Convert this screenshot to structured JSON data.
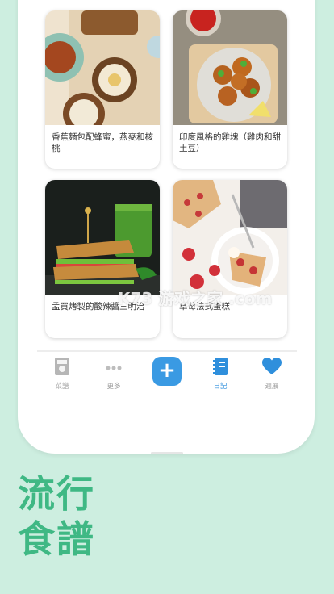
{
  "cards": [
    {
      "caption": "香蕉麵包配蜂蜜，燕麥和核桃"
    },
    {
      "caption": "印度風格的雞塊（雞肉和甜土豆）"
    },
    {
      "caption": "孟買烤製的酸辣醬三明治"
    },
    {
      "caption": "草莓法式蛋糕"
    }
  ],
  "tabs": [
    {
      "label": "菜譜",
      "icon": "recipe-book-icon"
    },
    {
      "label": "更多",
      "icon": "more-dots-icon"
    },
    {
      "label": "",
      "icon": "plus-icon"
    },
    {
      "label": "日記",
      "icon": "notebook-icon",
      "active": true
    },
    {
      "label": "週展",
      "icon": "heart-icon"
    }
  ],
  "promo": {
    "line1": "流行",
    "line2": "食譜"
  },
  "watermark": "K73 游戏之家 .com",
  "colors": {
    "background": "#cdeee0",
    "accent": "#2f8fdc",
    "promo": "#3fb884",
    "inactive": "#9c9c9c"
  }
}
